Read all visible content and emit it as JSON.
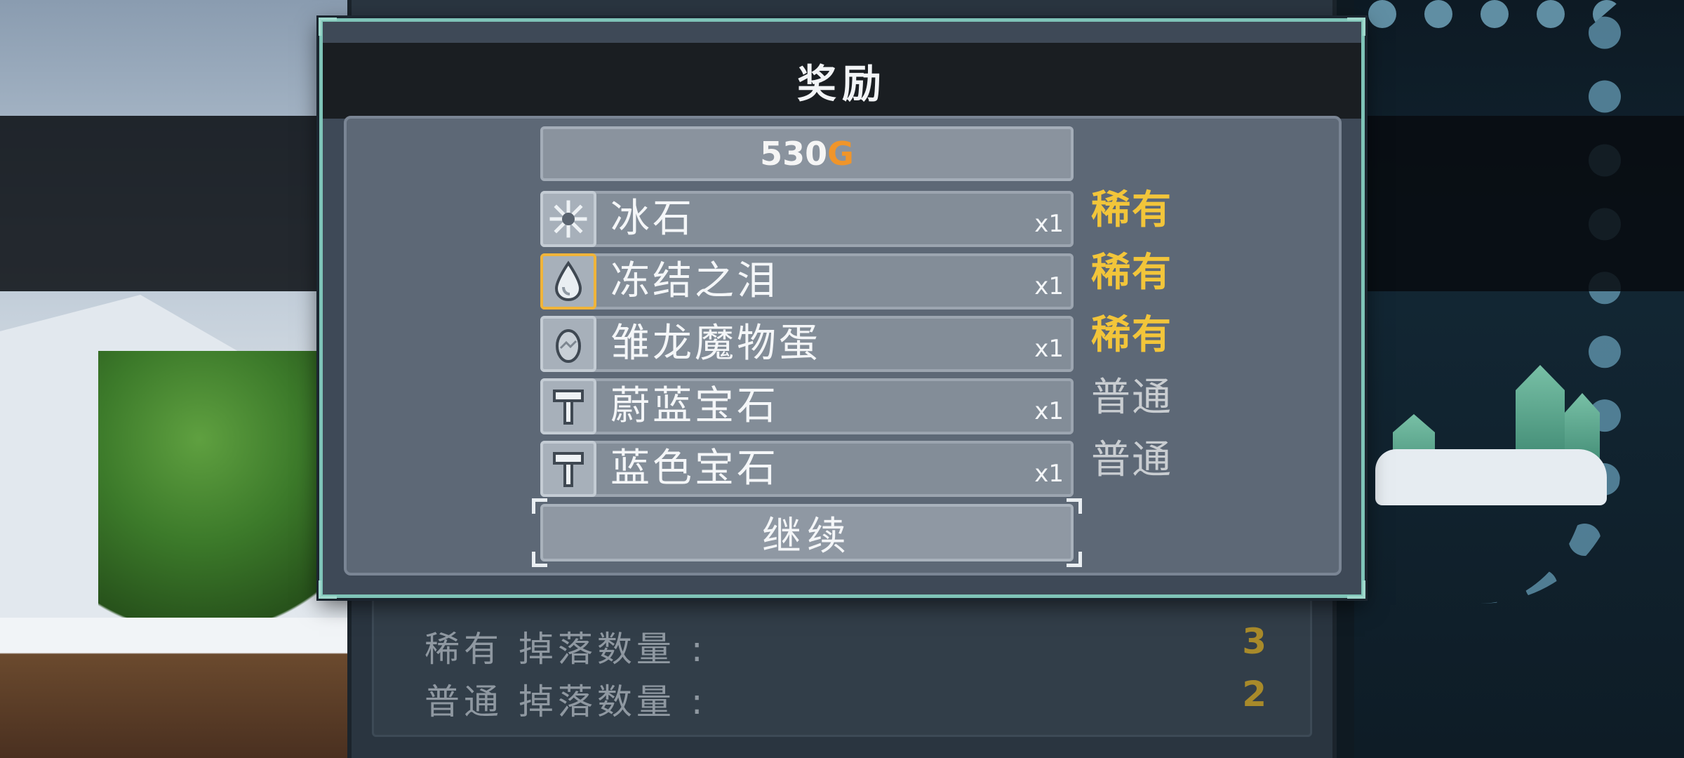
{
  "dialog": {
    "title": "奖励",
    "gold": {
      "amount": "530",
      "unit": "G"
    },
    "continue_label": "继续"
  },
  "rewards": [
    {
      "name": "冰石",
      "qty": "x1",
      "rarity": "稀有",
      "icon": "ice-stone-icon"
    },
    {
      "name": "冻结之泪",
      "qty": "x1",
      "rarity": "稀有",
      "icon": "frozen-tear-icon"
    },
    {
      "name": "雏龙魔物蛋",
      "qty": "x1",
      "rarity": "稀有",
      "icon": "dragon-egg-icon"
    },
    {
      "name": "蔚蓝宝石",
      "qty": "x1",
      "rarity": "普通",
      "icon": "hammer-icon"
    },
    {
      "name": "蓝色宝石",
      "qty": "x1",
      "rarity": "普通",
      "icon": "hammer-icon"
    }
  ],
  "stats": [
    {
      "label": "稀有 掉落数量 :",
      "value": "3"
    },
    {
      "label": "普通 掉落数量 :",
      "value": "2"
    }
  ],
  "colors": {
    "rare": "#f2c53a",
    "common": "#c9cdd1",
    "gold_unit": "#f0952a",
    "dialog_border": "#7fc4b8"
  }
}
